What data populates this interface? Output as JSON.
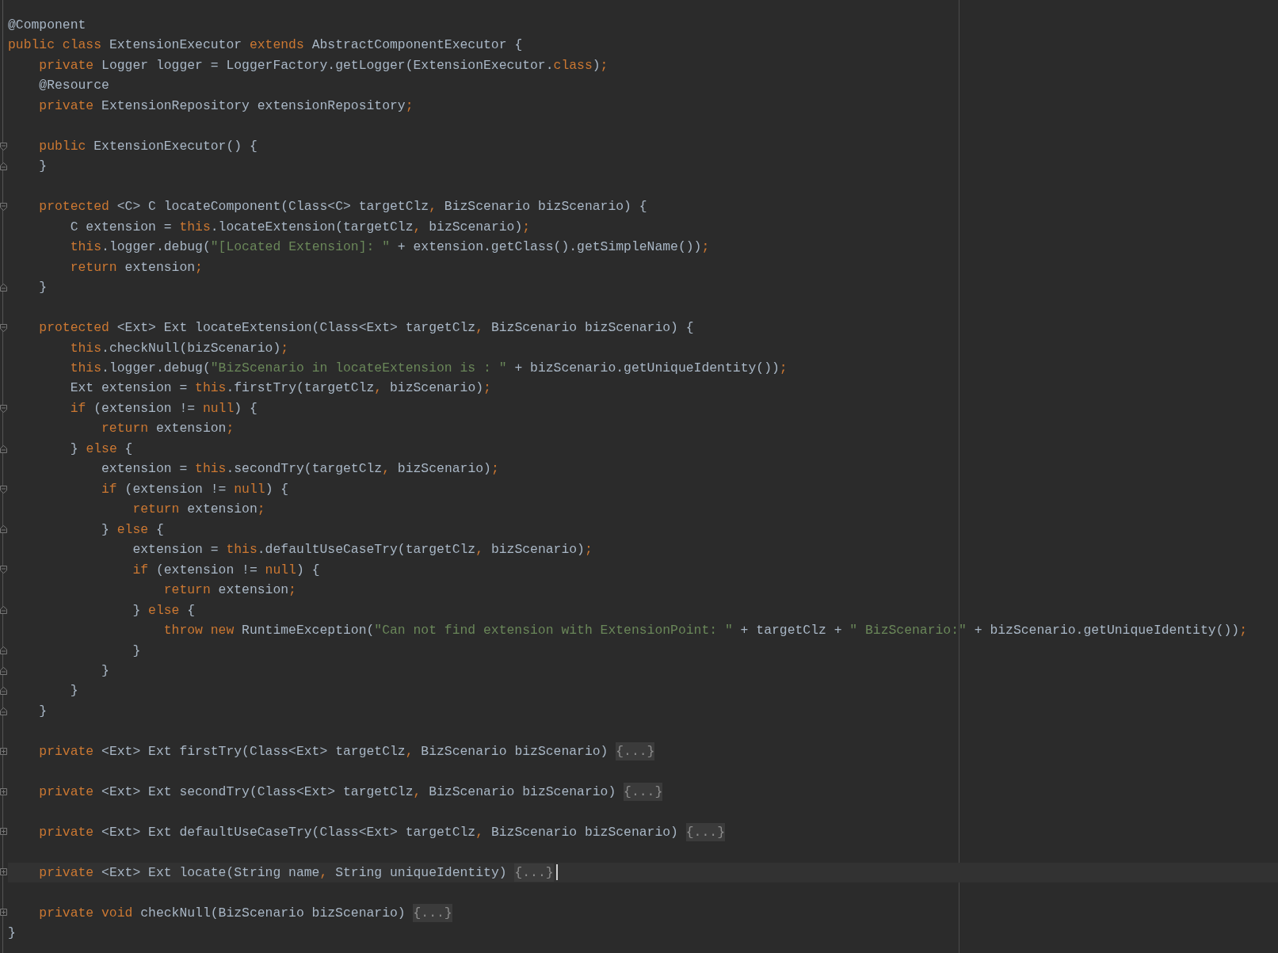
{
  "editor": {
    "lines": [
      {
        "kind": "code",
        "current": false,
        "fold_start": false,
        "fold_end": false,
        "collapsed": false,
        "tokens": [
          {
            "kind": "plain",
            "text": "@Component"
          }
        ]
      },
      {
        "kind": "code",
        "current": false,
        "fold_start": false,
        "fold_end": false,
        "collapsed": false,
        "tokens": [
          {
            "kind": "kw",
            "text": "public class "
          },
          {
            "kind": "plain",
            "text": "ExtensionExecutor "
          },
          {
            "kind": "kw",
            "text": "extends "
          },
          {
            "kind": "plain",
            "text": "AbstractComponentExecutor {"
          }
        ]
      },
      {
        "kind": "code",
        "current": false,
        "fold_start": false,
        "fold_end": false,
        "collapsed": false,
        "tokens": [
          {
            "kind": "kw",
            "text": "    private "
          },
          {
            "kind": "plain",
            "text": "Logger logger = LoggerFactory.getLogger(ExtensionExecutor."
          },
          {
            "kind": "kw",
            "text": "class"
          },
          {
            "kind": "plain",
            "text": ")"
          },
          {
            "kind": "kw",
            "text": ";"
          }
        ]
      },
      {
        "kind": "code",
        "current": false,
        "fold_start": false,
        "fold_end": false,
        "collapsed": false,
        "tokens": [
          {
            "kind": "plain",
            "text": "    @Resource"
          }
        ]
      },
      {
        "kind": "code",
        "current": false,
        "fold_start": false,
        "fold_end": false,
        "collapsed": false,
        "tokens": [
          {
            "kind": "kw",
            "text": "    private "
          },
          {
            "kind": "plain",
            "text": "ExtensionRepository extensionRepository"
          },
          {
            "kind": "kw",
            "text": ";"
          }
        ]
      },
      {
        "kind": "blank"
      },
      {
        "kind": "code",
        "current": false,
        "fold_start": true,
        "fold_end": false,
        "collapsed": false,
        "tokens": [
          {
            "kind": "kw",
            "text": "    public "
          },
          {
            "kind": "plain",
            "text": "ExtensionExecutor() {"
          }
        ]
      },
      {
        "kind": "code",
        "current": false,
        "fold_start": false,
        "fold_end": true,
        "collapsed": false,
        "tokens": [
          {
            "kind": "plain",
            "text": "    }"
          }
        ]
      },
      {
        "kind": "blank"
      },
      {
        "kind": "code",
        "current": false,
        "fold_start": true,
        "fold_end": false,
        "collapsed": false,
        "tokens": [
          {
            "kind": "kw",
            "text": "    protected "
          },
          {
            "kind": "plain",
            "text": "<C> C locateComponent(Class<C> targetClz"
          },
          {
            "kind": "kw",
            "text": ", "
          },
          {
            "kind": "plain",
            "text": "BizScenario bizScenario) {"
          }
        ]
      },
      {
        "kind": "code",
        "current": false,
        "fold_start": false,
        "fold_end": false,
        "collapsed": false,
        "tokens": [
          {
            "kind": "plain",
            "text": "        C extension = "
          },
          {
            "kind": "kw",
            "text": "this"
          },
          {
            "kind": "plain",
            "text": ".locateExtension(targetClz"
          },
          {
            "kind": "kw",
            "text": ", "
          },
          {
            "kind": "plain",
            "text": "bizScenario)"
          },
          {
            "kind": "kw",
            "text": ";"
          }
        ]
      },
      {
        "kind": "code",
        "current": false,
        "fold_start": false,
        "fold_end": false,
        "collapsed": false,
        "tokens": [
          {
            "kind": "kw",
            "text": "        this"
          },
          {
            "kind": "plain",
            "text": ".logger.debug("
          },
          {
            "kind": "str",
            "text": "\"[Located Extension]: \""
          },
          {
            "kind": "plain",
            "text": " + extension.getClass().getSimpleName())"
          },
          {
            "kind": "kw",
            "text": ";"
          }
        ]
      },
      {
        "kind": "code",
        "current": false,
        "fold_start": false,
        "fold_end": false,
        "collapsed": false,
        "tokens": [
          {
            "kind": "kw",
            "text": "        return "
          },
          {
            "kind": "plain",
            "text": "extension"
          },
          {
            "kind": "kw",
            "text": ";"
          }
        ]
      },
      {
        "kind": "code",
        "current": false,
        "fold_start": false,
        "fold_end": true,
        "collapsed": false,
        "tokens": [
          {
            "kind": "plain",
            "text": "    }"
          }
        ]
      },
      {
        "kind": "blank"
      },
      {
        "kind": "code",
        "current": false,
        "fold_start": true,
        "fold_end": false,
        "collapsed": false,
        "tokens": [
          {
            "kind": "kw",
            "text": "    protected "
          },
          {
            "kind": "plain",
            "text": "<Ext> Ext locateExtension(Class<Ext> targetClz"
          },
          {
            "kind": "kw",
            "text": ", "
          },
          {
            "kind": "plain",
            "text": "BizScenario bizScenario) {"
          }
        ]
      },
      {
        "kind": "code",
        "current": false,
        "fold_start": false,
        "fold_end": false,
        "collapsed": false,
        "tokens": [
          {
            "kind": "kw",
            "text": "        this"
          },
          {
            "kind": "plain",
            "text": ".checkNull(bizScenario)"
          },
          {
            "kind": "kw",
            "text": ";"
          }
        ]
      },
      {
        "kind": "code",
        "current": false,
        "fold_start": false,
        "fold_end": false,
        "collapsed": false,
        "tokens": [
          {
            "kind": "kw",
            "text": "        this"
          },
          {
            "kind": "plain",
            "text": ".logger.debug("
          },
          {
            "kind": "str",
            "text": "\"BizScenario in locateExtension is : \""
          },
          {
            "kind": "plain",
            "text": " + bizScenario.getUniqueIdentity())"
          },
          {
            "kind": "kw",
            "text": ";"
          }
        ]
      },
      {
        "kind": "code",
        "current": false,
        "fold_start": false,
        "fold_end": false,
        "collapsed": false,
        "tokens": [
          {
            "kind": "plain",
            "text": "        Ext extension = "
          },
          {
            "kind": "kw",
            "text": "this"
          },
          {
            "kind": "plain",
            "text": ".firstTry(targetClz"
          },
          {
            "kind": "kw",
            "text": ", "
          },
          {
            "kind": "plain",
            "text": "bizScenario)"
          },
          {
            "kind": "kw",
            "text": ";"
          }
        ]
      },
      {
        "kind": "code",
        "current": false,
        "fold_start": true,
        "fold_end": false,
        "collapsed": false,
        "tokens": [
          {
            "kind": "kw",
            "text": "        if "
          },
          {
            "kind": "plain",
            "text": "(extension != "
          },
          {
            "kind": "kw",
            "text": "null"
          },
          {
            "kind": "plain",
            "text": ") {"
          }
        ]
      },
      {
        "kind": "code",
        "current": false,
        "fold_start": false,
        "fold_end": false,
        "collapsed": false,
        "tokens": [
          {
            "kind": "kw",
            "text": "            return "
          },
          {
            "kind": "plain",
            "text": "extension"
          },
          {
            "kind": "kw",
            "text": ";"
          }
        ]
      },
      {
        "kind": "code",
        "current": false,
        "fold_start": false,
        "fold_end": true,
        "collapsed": false,
        "tokens": [
          {
            "kind": "plain",
            "text": "        } "
          },
          {
            "kind": "kw",
            "text": "else "
          },
          {
            "kind": "plain",
            "text": "{"
          }
        ]
      },
      {
        "kind": "code",
        "current": false,
        "fold_start": false,
        "fold_end": false,
        "collapsed": false,
        "tokens": [
          {
            "kind": "plain",
            "text": "            extension = "
          },
          {
            "kind": "kw",
            "text": "this"
          },
          {
            "kind": "plain",
            "text": ".secondTry(targetClz"
          },
          {
            "kind": "kw",
            "text": ", "
          },
          {
            "kind": "plain",
            "text": "bizScenario)"
          },
          {
            "kind": "kw",
            "text": ";"
          }
        ]
      },
      {
        "kind": "code",
        "current": false,
        "fold_start": true,
        "fold_end": false,
        "collapsed": false,
        "tokens": [
          {
            "kind": "kw",
            "text": "            if "
          },
          {
            "kind": "plain",
            "text": "(extension != "
          },
          {
            "kind": "kw",
            "text": "null"
          },
          {
            "kind": "plain",
            "text": ") {"
          }
        ]
      },
      {
        "kind": "code",
        "current": false,
        "fold_start": false,
        "fold_end": false,
        "collapsed": false,
        "tokens": [
          {
            "kind": "kw",
            "text": "                return "
          },
          {
            "kind": "plain",
            "text": "extension"
          },
          {
            "kind": "kw",
            "text": ";"
          }
        ]
      },
      {
        "kind": "code",
        "current": false,
        "fold_start": false,
        "fold_end": true,
        "collapsed": false,
        "tokens": [
          {
            "kind": "plain",
            "text": "            } "
          },
          {
            "kind": "kw",
            "text": "else "
          },
          {
            "kind": "plain",
            "text": "{"
          }
        ]
      },
      {
        "kind": "code",
        "current": false,
        "fold_start": false,
        "fold_end": false,
        "collapsed": false,
        "tokens": [
          {
            "kind": "plain",
            "text": "                extension = "
          },
          {
            "kind": "kw",
            "text": "this"
          },
          {
            "kind": "plain",
            "text": ".defaultUseCaseTry(targetClz"
          },
          {
            "kind": "kw",
            "text": ", "
          },
          {
            "kind": "plain",
            "text": "bizScenario)"
          },
          {
            "kind": "kw",
            "text": ";"
          }
        ]
      },
      {
        "kind": "code",
        "current": false,
        "fold_start": true,
        "fold_end": false,
        "collapsed": false,
        "tokens": [
          {
            "kind": "kw",
            "text": "                if "
          },
          {
            "kind": "plain",
            "text": "(extension != "
          },
          {
            "kind": "kw",
            "text": "null"
          },
          {
            "kind": "plain",
            "text": ") {"
          }
        ]
      },
      {
        "kind": "code",
        "current": false,
        "fold_start": false,
        "fold_end": false,
        "collapsed": false,
        "tokens": [
          {
            "kind": "kw",
            "text": "                    return "
          },
          {
            "kind": "plain",
            "text": "extension"
          },
          {
            "kind": "kw",
            "text": ";"
          }
        ]
      },
      {
        "kind": "code",
        "current": false,
        "fold_start": false,
        "fold_end": true,
        "collapsed": false,
        "tokens": [
          {
            "kind": "plain",
            "text": "                } "
          },
          {
            "kind": "kw",
            "text": "else "
          },
          {
            "kind": "plain",
            "text": "{"
          }
        ]
      },
      {
        "kind": "code",
        "current": false,
        "fold_start": false,
        "fold_end": false,
        "collapsed": false,
        "tokens": [
          {
            "kind": "kw",
            "text": "                    throw new "
          },
          {
            "kind": "plain",
            "text": "RuntimeException("
          },
          {
            "kind": "str",
            "text": "\"Can not find extension with ExtensionPoint: \""
          },
          {
            "kind": "plain",
            "text": " + targetClz + "
          },
          {
            "kind": "str",
            "text": "\" BizScenario:\""
          },
          {
            "kind": "plain",
            "text": " + bizScenario.getUniqueIdentity())"
          },
          {
            "kind": "kw",
            "text": ";"
          }
        ]
      },
      {
        "kind": "code",
        "current": false,
        "fold_start": false,
        "fold_end": true,
        "collapsed": false,
        "tokens": [
          {
            "kind": "plain",
            "text": "                }"
          }
        ]
      },
      {
        "kind": "code",
        "current": false,
        "fold_start": false,
        "fold_end": true,
        "collapsed": false,
        "tokens": [
          {
            "kind": "plain",
            "text": "            }"
          }
        ]
      },
      {
        "kind": "code",
        "current": false,
        "fold_start": false,
        "fold_end": true,
        "collapsed": false,
        "tokens": [
          {
            "kind": "plain",
            "text": "        }"
          }
        ]
      },
      {
        "kind": "code",
        "current": false,
        "fold_start": false,
        "fold_end": true,
        "collapsed": false,
        "tokens": [
          {
            "kind": "plain",
            "text": "    }"
          }
        ]
      },
      {
        "kind": "blank"
      },
      {
        "kind": "code",
        "current": false,
        "fold_start": false,
        "fold_end": false,
        "collapsed": true,
        "tokens": [
          {
            "kind": "kw",
            "text": "    private "
          },
          {
            "kind": "plain",
            "text": "<Ext> Ext firstTry(Class<Ext> targetClz"
          },
          {
            "kind": "kw",
            "text": ", "
          },
          {
            "kind": "plain",
            "text": "BizScenario bizScenario) "
          },
          {
            "kind": "folded",
            "text": "{...}"
          }
        ]
      },
      {
        "kind": "blank"
      },
      {
        "kind": "code",
        "current": false,
        "fold_start": false,
        "fold_end": false,
        "collapsed": true,
        "tokens": [
          {
            "kind": "kw",
            "text": "    private "
          },
          {
            "kind": "plain",
            "text": "<Ext> Ext secondTry(Class<Ext> targetClz"
          },
          {
            "kind": "kw",
            "text": ", "
          },
          {
            "kind": "plain",
            "text": "BizScenario bizScenario) "
          },
          {
            "kind": "folded",
            "text": "{...}"
          }
        ]
      },
      {
        "kind": "blank"
      },
      {
        "kind": "code",
        "current": false,
        "fold_start": false,
        "fold_end": false,
        "collapsed": true,
        "tokens": [
          {
            "kind": "kw",
            "text": "    private "
          },
          {
            "kind": "plain",
            "text": "<Ext> Ext defaultUseCaseTry(Class<Ext> targetClz"
          },
          {
            "kind": "kw",
            "text": ", "
          },
          {
            "kind": "plain",
            "text": "BizScenario bizScenario) "
          },
          {
            "kind": "folded",
            "text": "{...}"
          }
        ]
      },
      {
        "kind": "blank"
      },
      {
        "kind": "code",
        "current": true,
        "fold_start": false,
        "fold_end": false,
        "collapsed": true,
        "tokens": [
          {
            "kind": "kw",
            "text": "    private "
          },
          {
            "kind": "plain",
            "text": "<Ext> Ext locate(String name"
          },
          {
            "kind": "kw",
            "text": ", "
          },
          {
            "kind": "plain",
            "text": "String uniqueIdentity) "
          },
          {
            "kind": "folded",
            "text": "{...}"
          }
        ]
      },
      {
        "kind": "blank"
      },
      {
        "kind": "code",
        "current": false,
        "fold_start": false,
        "fold_end": false,
        "collapsed": true,
        "tokens": [
          {
            "kind": "kw",
            "text": "    private void "
          },
          {
            "kind": "plain",
            "text": "checkNull(BizScenario bizScenario) "
          },
          {
            "kind": "folded",
            "text": "{...}"
          }
        ]
      },
      {
        "kind": "code",
        "current": false,
        "fold_start": false,
        "fold_end": false,
        "collapsed": false,
        "tokens": [
          {
            "kind": "plain",
            "text": "}"
          }
        ]
      }
    ]
  }
}
